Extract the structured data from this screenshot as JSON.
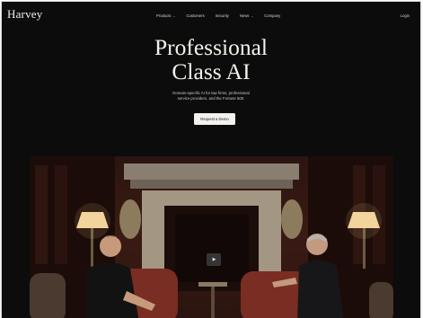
{
  "brand": {
    "logo": "Harvey"
  },
  "nav": {
    "items": [
      {
        "label": "Products",
        "caret": "⌄"
      },
      {
        "label": "Customers"
      },
      {
        "label": "Security"
      },
      {
        "label": "News",
        "caret": "⌄"
      },
      {
        "label": "Company"
      }
    ],
    "login": "Login"
  },
  "hero": {
    "title_line1": "Professional",
    "title_line2": "Class AI",
    "subtitle_line1": "Domain-specific AI for law firms, professional",
    "subtitle_line2": "service providers, and the Fortune 500.",
    "cta_label": "Request a Demo"
  },
  "video": {
    "play_icon": "play-icon",
    "play_glyph": "▶"
  },
  "colors": {
    "background": "#0c0c0c",
    "text": "#f4f1ea",
    "cta_bg": "#f4f2ee"
  }
}
